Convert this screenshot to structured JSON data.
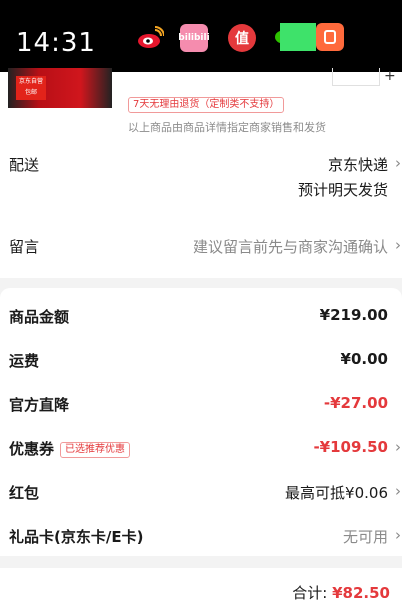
{
  "status_bar": {
    "time": "14:31",
    "icons": [
      "weibo-icon",
      "bilibili-icon",
      "zhidemai-icon",
      "wechat-icon",
      "notification-icon"
    ],
    "bili_text": "bilibili",
    "zhi_text": "值"
  },
  "product": {
    "thumb_tag": "京东自营 包邮",
    "return_tag": "7天无理由退货（定制类不支持）",
    "notice": "以上商品由商品详情指定商家销售和发货"
  },
  "delivery": {
    "label": "配送",
    "carrier": "京东快递",
    "eta": "预计明天发货"
  },
  "message": {
    "label": "留言",
    "placeholder": "建议留言前先与商家沟通确认"
  },
  "summary": {
    "goods_amount_label": "商品金额",
    "goods_amount_value": "¥219.00",
    "shipping_label": "运费",
    "shipping_value": "¥0.00",
    "official_discount_label": "官方直降",
    "official_discount_value": "-¥27.00",
    "coupon_label": "优惠券",
    "coupon_tag": "已选推荐优惠",
    "coupon_value": "-¥109.50",
    "red_packet_label": "红包",
    "red_packet_value": "最高可抵¥0.06",
    "gift_card_label": "礼品卡(京东卡/E卡)",
    "gift_card_value": "无可用"
  },
  "footer": {
    "total_label": "合计:",
    "total_value": "¥82.50"
  },
  "colors": {
    "accent_red": "#e4393c",
    "muted_gray": "#888888"
  }
}
